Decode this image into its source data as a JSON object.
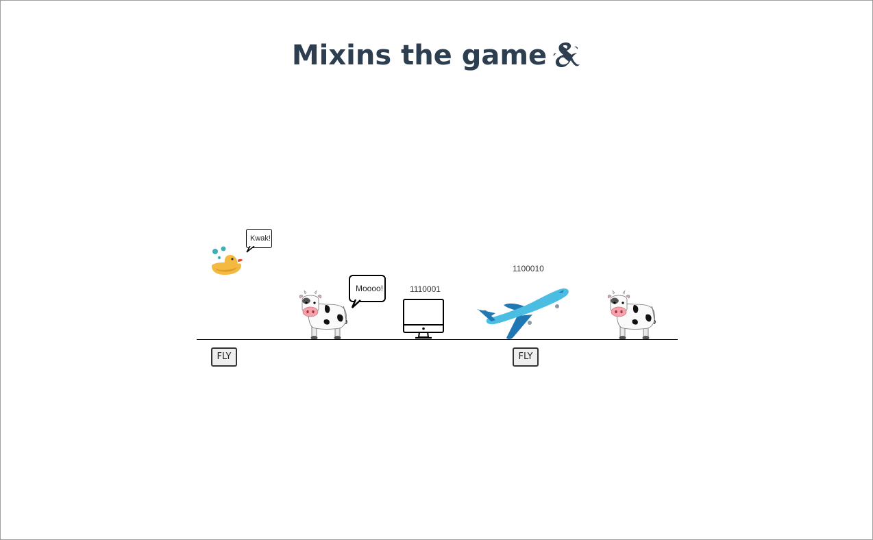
{
  "title": "Mixins the game",
  "title_icon": "ampersand-logo-icon",
  "colors": {
    "title": "#2c3e50",
    "duck": "#f4b940",
    "airplane": "#4bbde3",
    "airplane_dark": "#1f78b4"
  },
  "entities": [
    {
      "kind": "duck",
      "icon": "duck-icon",
      "speech": "Kwak!",
      "button": "FLY"
    },
    {
      "kind": "cow",
      "icon": "cow-icon",
      "speech": "Moooo!"
    },
    {
      "kind": "computer",
      "icon": "computer-icon",
      "binary": "1110001"
    },
    {
      "kind": "airplane",
      "icon": "airplane-icon",
      "binary": "1100010",
      "button": "FLY"
    },
    {
      "kind": "cow",
      "icon": "cow-icon"
    }
  ]
}
